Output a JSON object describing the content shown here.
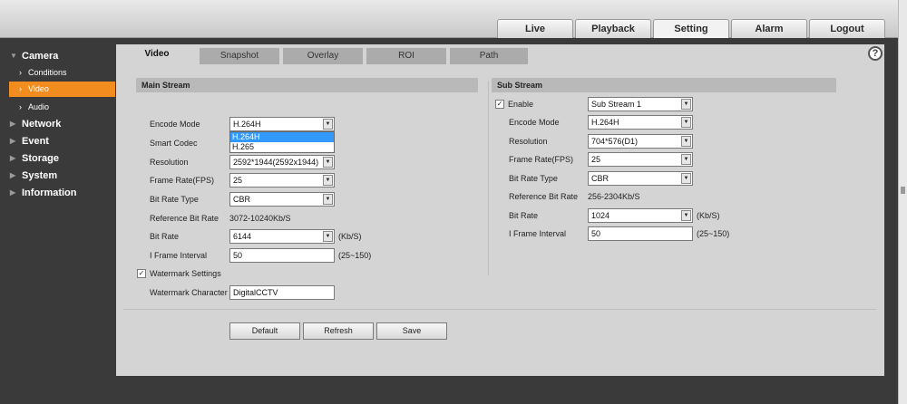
{
  "top_nav": {
    "tabs": [
      {
        "label": "Live"
      },
      {
        "label": "Playback"
      },
      {
        "label": "Setting"
      },
      {
        "label": "Alarm"
      },
      {
        "label": "Logout"
      }
    ],
    "active": "Setting"
  },
  "sidebar": {
    "camera": "Camera",
    "camera_items": [
      {
        "label": "Conditions"
      },
      {
        "label": "Video"
      },
      {
        "label": "Audio"
      }
    ],
    "active_item": "Video",
    "sections": [
      {
        "label": "Network"
      },
      {
        "label": "Event"
      },
      {
        "label": "Storage"
      },
      {
        "label": "System"
      },
      {
        "label": "Information"
      }
    ]
  },
  "sub_tabs": [
    {
      "label": "Video"
    },
    {
      "label": "Snapshot"
    },
    {
      "label": "Overlay"
    },
    {
      "label": "ROI"
    },
    {
      "label": "Path"
    }
  ],
  "help_glyph": "?",
  "main_stream": {
    "title": "Main Stream",
    "encode_mode_label": "Encode Mode",
    "encode_mode": "H.264H",
    "encode_mode_options": [
      "H.264H",
      "H.265"
    ],
    "smart_codec_label": "Smart Codec",
    "resolution_label": "Resolution",
    "resolution": "2592*1944(2592x1944)",
    "frame_rate_label": "Frame Rate(FPS)",
    "frame_rate": "25",
    "bit_rate_type_label": "Bit Rate Type",
    "bit_rate_type": "CBR",
    "ref_bit_rate_label": "Reference Bit Rate",
    "ref_bit_rate": "3072-10240Kb/S",
    "bit_rate_label": "Bit Rate",
    "bit_rate": "6144",
    "bit_rate_unit": "(Kb/S)",
    "iframe_label": "I Frame Interval",
    "iframe": "50",
    "iframe_range": "(25~150)",
    "watermark_settings_label": "Watermark Settings",
    "watermark_checked": "✓",
    "watermark_char_label": "Watermark Character",
    "watermark_char": "DigitalCCTV"
  },
  "sub_stream": {
    "title": "Sub Stream",
    "enable_label": "Enable",
    "enable_checked": "✓",
    "enable_value": "Sub Stream 1",
    "encode_mode_label": "Encode Mode",
    "encode_mode": "H.264H",
    "resolution_label": "Resolution",
    "resolution": "704*576(D1)",
    "frame_rate_label": "Frame Rate(FPS)",
    "frame_rate": "25",
    "bit_rate_type_label": "Bit Rate Type",
    "bit_rate_type": "CBR",
    "ref_bit_rate_label": "Reference Bit Rate",
    "ref_bit_rate": "256-2304Kb/S",
    "bit_rate_label": "Bit Rate",
    "bit_rate": "1024",
    "bit_rate_unit": "(Kb/S)",
    "iframe_label": "I Frame Interval",
    "iframe": "50",
    "iframe_range": "(25~150)"
  },
  "buttons": {
    "default": "Default",
    "refresh": "Refresh",
    "save": "Save"
  },
  "icons": {
    "dropdown": "▼",
    "side_arrow": "›",
    "section_arrow": "▶",
    "section_expanded": "▼"
  }
}
